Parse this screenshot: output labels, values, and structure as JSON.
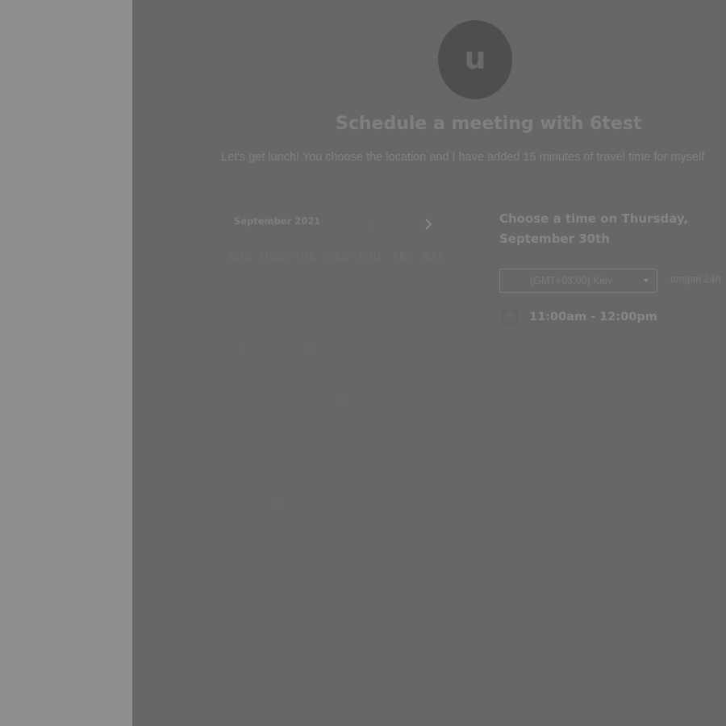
{
  "header": {
    "avatar_letter": "u",
    "title": "Schedule a meeting with 6test",
    "description": "Let's get lunch! You choose the location and I have added 15 minutes of travel time for myself"
  },
  "calendar": {
    "month_label": "September 2021",
    "prev_icon": "chevron-left-icon",
    "next_icon": "chevron-right-icon",
    "weekdays": [
      "SUN",
      "MON",
      "TUE",
      "WED",
      "THU",
      "FRI",
      "SAT"
    ],
    "visible_days": [
      "1",
      "3",
      "11",
      "12"
    ]
  },
  "time_panel": {
    "heading": "Choose a time on Thursday, September 30th",
    "timezone": "(GMT+03:00) Kiev",
    "format_toggle": "am/pm  24h",
    "slots": [
      "11:00am - 12:00pm"
    ]
  },
  "colors": {
    "overlay_background": "#676767",
    "sidebar_background": "#8f8f8f"
  }
}
